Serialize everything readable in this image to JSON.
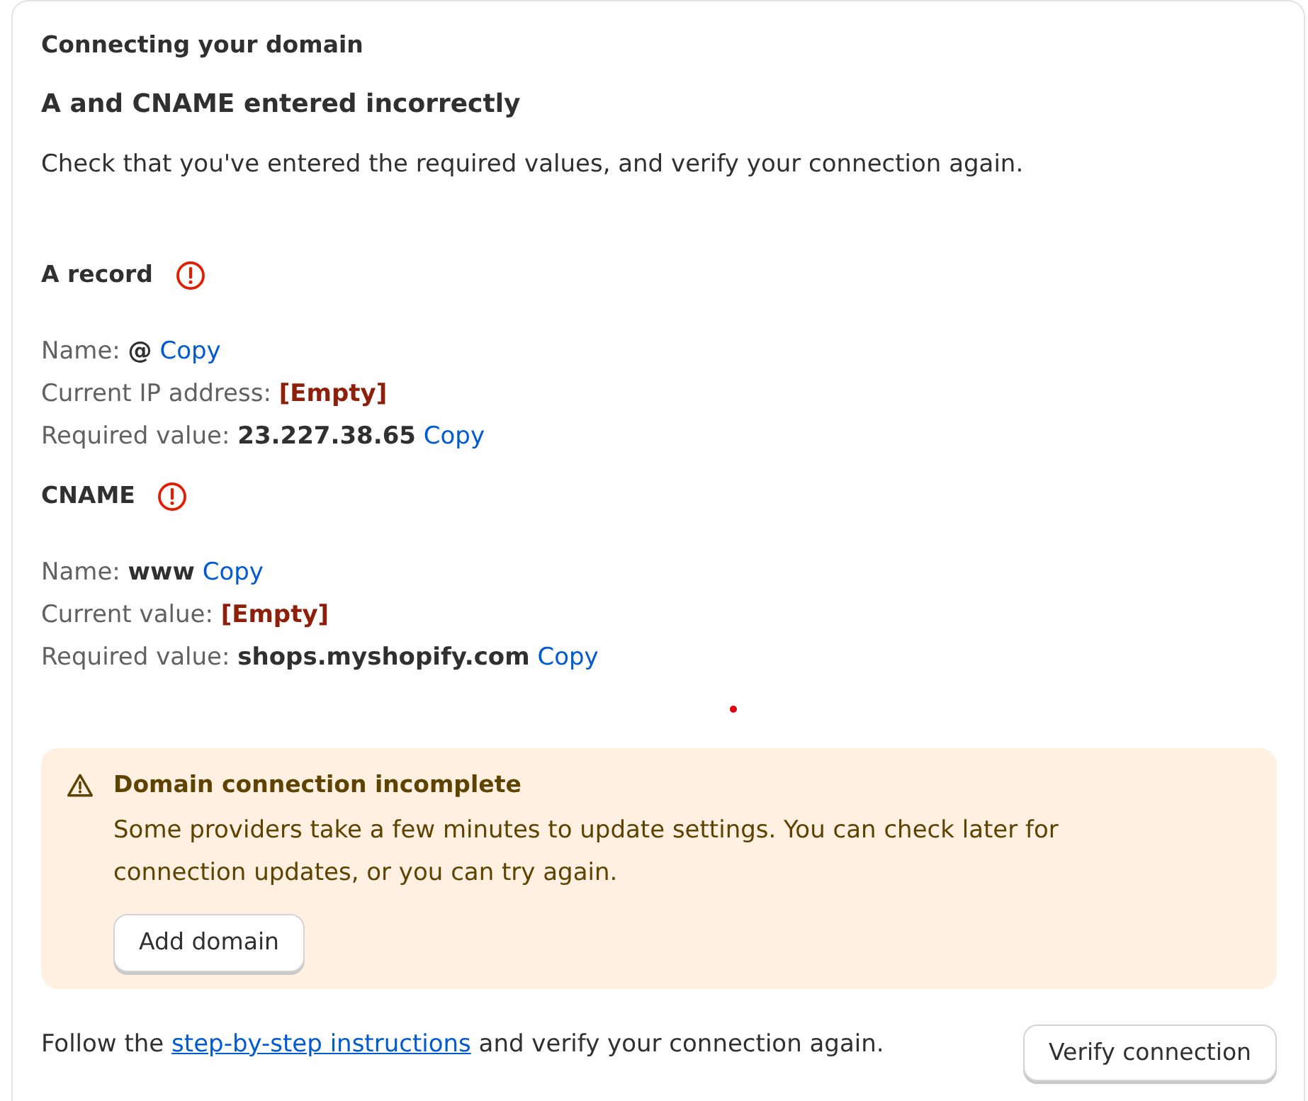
{
  "card": {
    "title": "Connecting your domain",
    "status_heading": "A and CNAME entered incorrectly",
    "description": "Check that you've entered the required values, and verify your connection again."
  },
  "records": [
    {
      "title": "A record",
      "error": true,
      "fields": [
        {
          "label": "Name:",
          "value": "@",
          "kind": "value",
          "copy": "Copy"
        },
        {
          "label": "Current IP address:",
          "value": "[Empty]",
          "kind": "missing"
        },
        {
          "label": "Required value:",
          "value": "23.227.38.65",
          "kind": "value",
          "copy": "Copy"
        }
      ]
    },
    {
      "title": "CNAME",
      "error": true,
      "fields": [
        {
          "label": "Name:",
          "value": "www",
          "kind": "value",
          "copy": "Copy"
        },
        {
          "label": "Current value:",
          "value": "[Empty]",
          "kind": "missing"
        },
        {
          "label": "Required value:",
          "value": "shops.myshopify.com",
          "kind": "value",
          "copy": "Copy"
        }
      ]
    }
  ],
  "banner": {
    "title": "Domain connection incomplete",
    "text": "Some providers take a few minutes to update settings. You can check later for connection updates, or you can try again.",
    "button": "Add domain"
  },
  "footer": {
    "text_before": "Follow the",
    "link": "step-by-step instructions",
    "text_after": "and verify your connection again.",
    "button": "Verify connection"
  }
}
